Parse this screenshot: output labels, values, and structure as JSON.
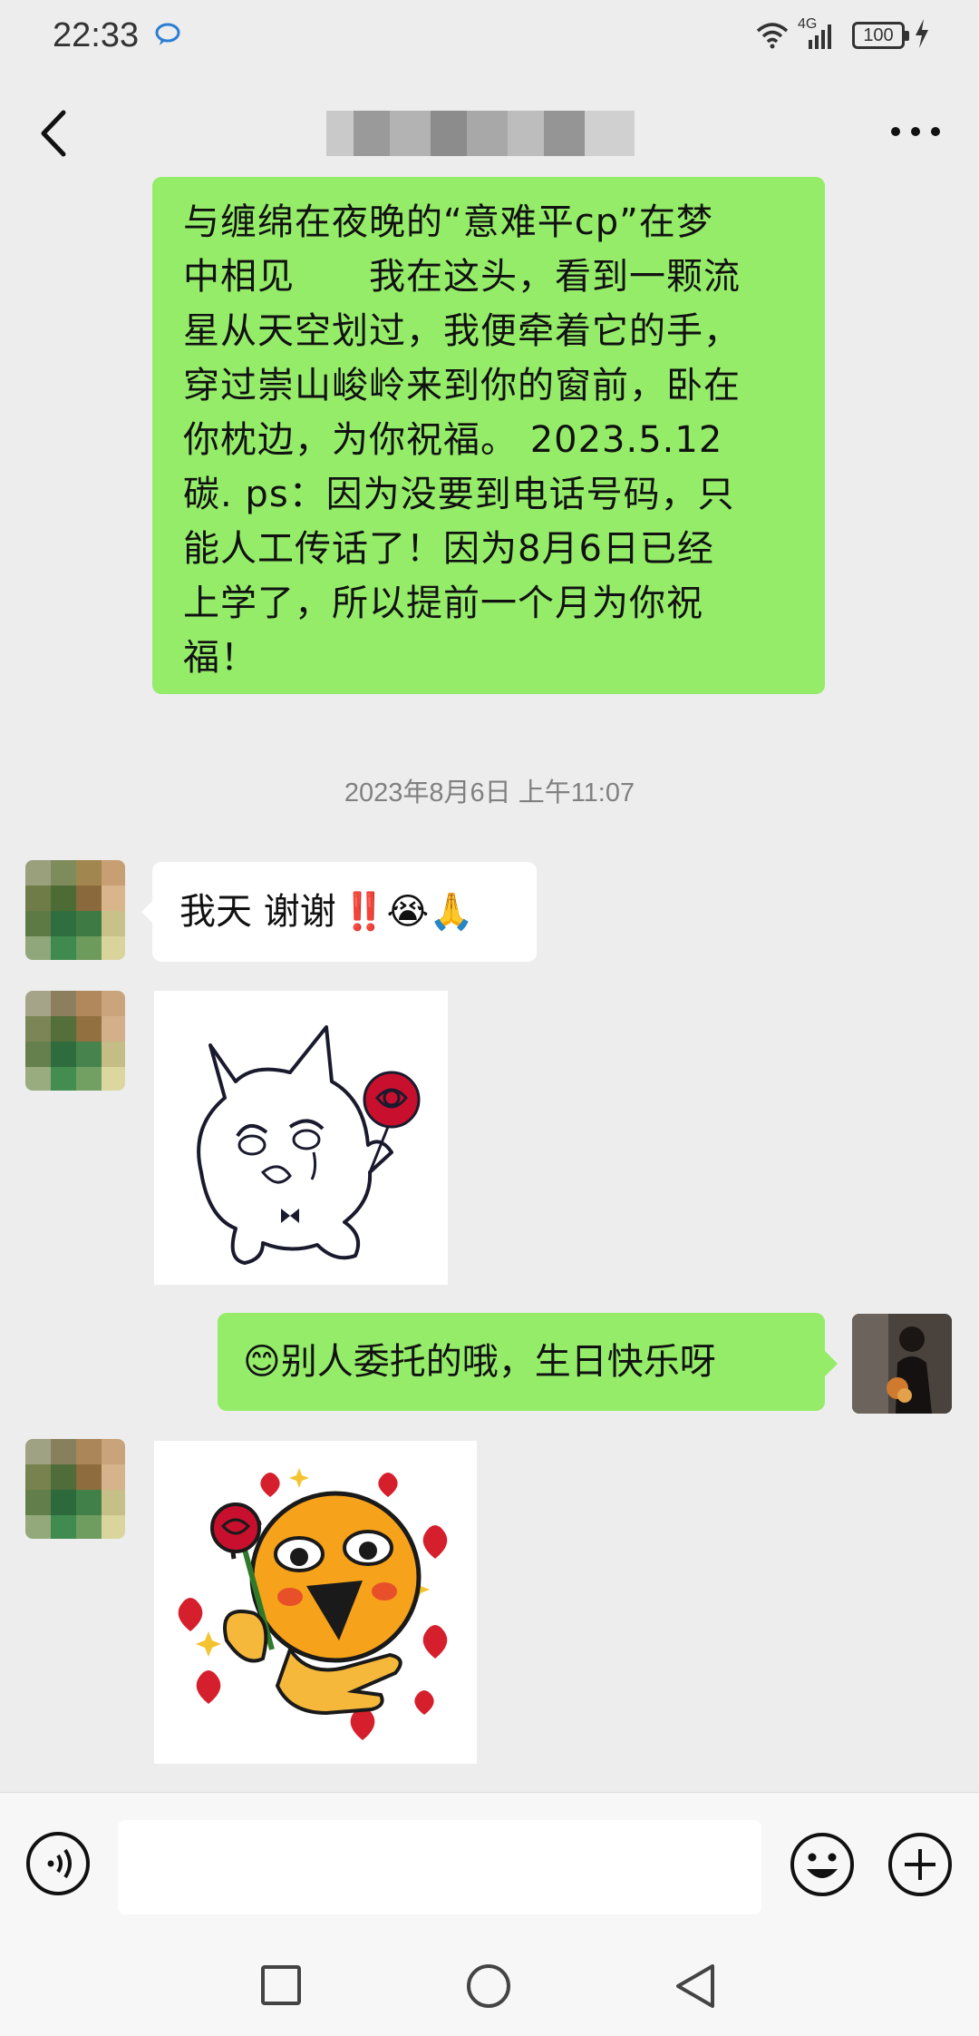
{
  "status_bar": {
    "time": "22:33",
    "network": "4G",
    "battery": "100"
  },
  "nav": {
    "back_icon": "chevron-left-icon",
    "contact_name": "",
    "more_icon": "more-dots-icon"
  },
  "messages": {
    "long_text": "与缠绵在夜晚的“意难平cp”在梦\n中相见　　我在这头，看到一颗流\n星从天空划过，我便牵着它的手，\n穿过崇山峻岭来到你的窗前，卧在\n你枕边，为你祝福。 2023.5.12\n碳. ps：因为没要到电话号码，只\n能人工传话了！因为8月6日已经\n上学了，所以提前一个月为你祝\n福！",
    "timestamp": "2023年8月6日 上午11:07",
    "reply_text": "我天 谢谢",
    "reply_emojis": "‼️😭🙏",
    "blessing_emoji": "😊",
    "blessing_text": "别人委托的哦，生日快乐呀"
  },
  "input_bar": {
    "placeholder": "",
    "voice_icon": "voice-icon",
    "emoji_icon": "emoji-icon",
    "plus_icon": "plus-icon"
  },
  "colors": {
    "outgoing_bubble": "#95ec69",
    "incoming_bubble": "#ffffff",
    "chat_background": "#ededed"
  }
}
